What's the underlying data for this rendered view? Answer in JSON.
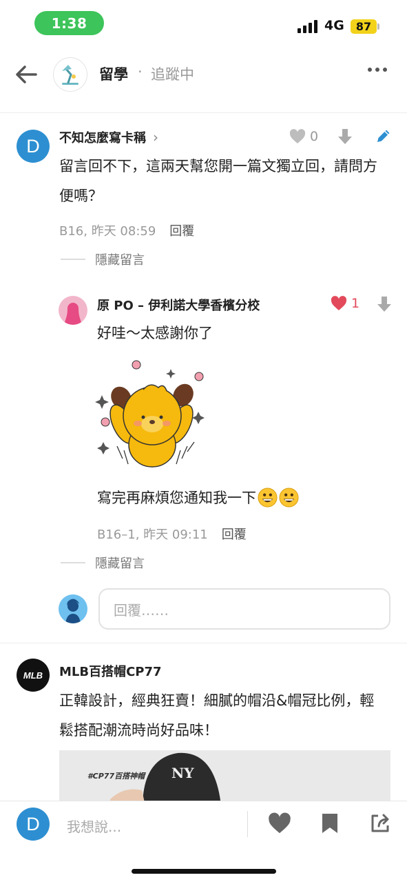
{
  "status_bar": {
    "time": "1:38",
    "network": "4G",
    "battery": "87"
  },
  "header": {
    "board_name": "留學",
    "separator": "·",
    "follow_status": "追蹤中"
  },
  "comments": [
    {
      "author": "不知怎麼寫卡稱",
      "likes": "0",
      "body": "留言回不下，這兩天幫您開一篇文獨立回，請問方便嗎？",
      "floor": "B16, 昨天 08:59",
      "reply_label": "回覆",
      "hide_label": "隱藏留言"
    },
    {
      "author": "原 PO – 伊利諾大學香檳分校",
      "likes": "1",
      "body": "好哇～太感謝你了",
      "body2": "寫完再麻煩您通知我一下",
      "floor": "B16–1, 昨天 09:11",
      "reply_label": "回覆",
      "hide_label": "隱藏留言"
    }
  ],
  "reply_box": {
    "placeholder": "回覆……"
  },
  "ad": {
    "author": "MLB百搭帽CP77",
    "logo_text": "MLB",
    "body": "正韓設計，經典狂賣！細膩的帽沿&帽冠比例，輕鬆搭配潮流時尚好品味！",
    "image_tag": "#CP77百搭神帽"
  },
  "bottom_bar": {
    "avatar_letter": "D",
    "placeholder": "我想說..."
  },
  "avatar_letter": "D",
  "colors": {
    "accent_blue": "#2d8fd1",
    "like_red": "#e24a5b",
    "time_green": "#3dc45a",
    "battery_yellow": "#f2d21b"
  }
}
